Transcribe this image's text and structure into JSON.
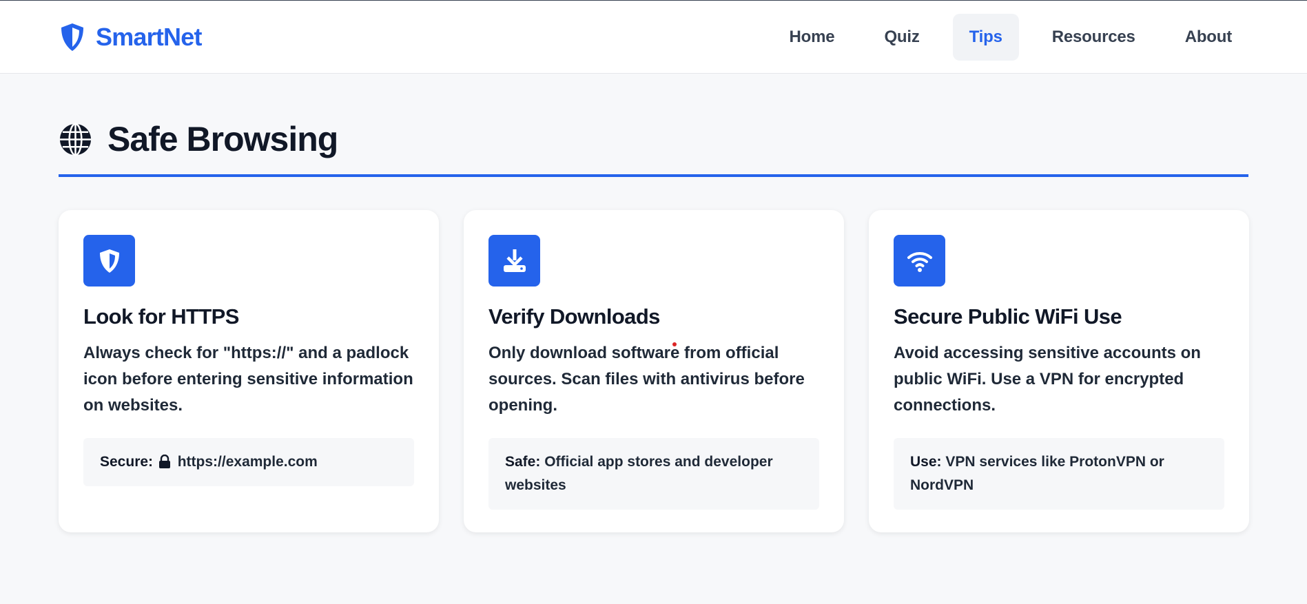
{
  "brand": {
    "name": "SmartNet",
    "icon": "shield-icon",
    "color": "#2563eb"
  },
  "nav": {
    "items": [
      {
        "label": "Home",
        "active": false
      },
      {
        "label": "Quiz",
        "active": false
      },
      {
        "label": "Tips",
        "active": true
      },
      {
        "label": "Resources",
        "active": false
      },
      {
        "label": "About",
        "active": false
      }
    ]
  },
  "section": {
    "title": "Safe Browsing",
    "icon": "globe-icon"
  },
  "cards": [
    {
      "icon": "shield-icon",
      "title": "Look for HTTPS",
      "text": "Always check for \"https://\" and a padlock icon before entering sensitive information on websites.",
      "note_label": "Secure:",
      "note_text": "https://example.com",
      "note_icon": "lock-icon"
    },
    {
      "icon": "download-icon",
      "title": "Verify Downloads",
      "text": "Only download software from official sources. Scan files with antivirus before opening.",
      "note_label": "Safe:",
      "note_text": "Official app stores and developer websites"
    },
    {
      "icon": "wifi-icon",
      "title": "Secure Public WiFi Use",
      "text": "Avoid accessing sensitive accounts on public WiFi. Use a VPN for encrypted connections.",
      "note_label": "Use:",
      "note_text": "VPN services like ProtonVPN or NordVPN"
    }
  ],
  "colors": {
    "accent": "#2563eb",
    "background": "#f7f8fa",
    "heading": "#111827"
  }
}
